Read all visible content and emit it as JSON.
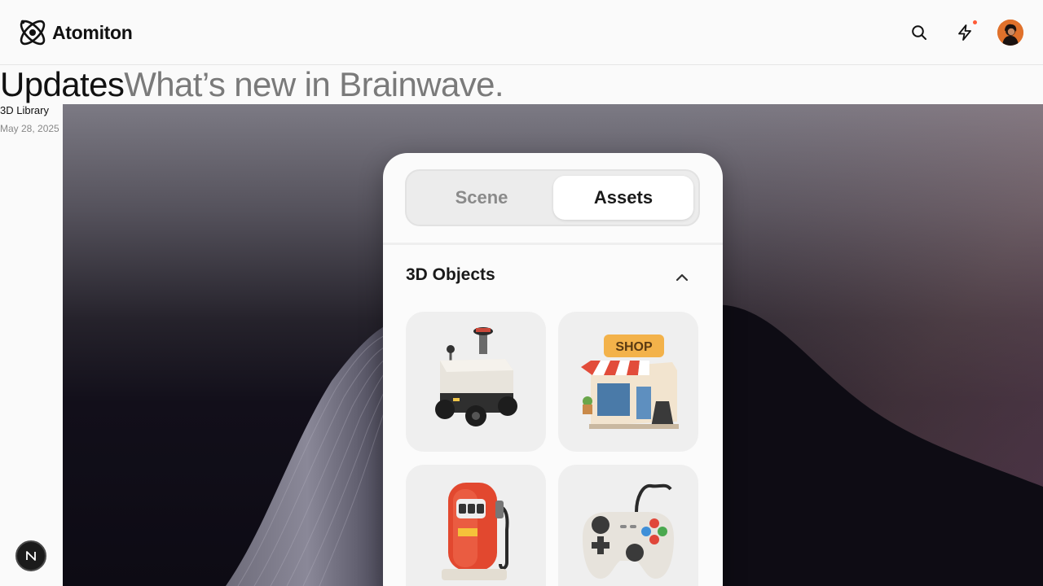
{
  "brand": {
    "name": "Atomiton"
  },
  "header": {
    "search_icon": "search-icon",
    "updates_icon": "lightning-icon",
    "notification_color": "#ff5a36",
    "avatar_color": "#e0712b"
  },
  "page": {
    "title": "Updates",
    "subtitle": "What’s new in Brainwave."
  },
  "post": {
    "category": "3D Library",
    "date": "May 28, 2025"
  },
  "mockup": {
    "tabs": [
      {
        "label": "Scene",
        "active": false
      },
      {
        "label": "Assets",
        "active": true
      }
    ],
    "section_title": "3D Objects",
    "shop_sign": "SHOP",
    "objects": [
      "delivery-robot",
      "shop",
      "fuel-pump",
      "game-controller"
    ]
  },
  "dev_badge": {
    "label": "N"
  }
}
